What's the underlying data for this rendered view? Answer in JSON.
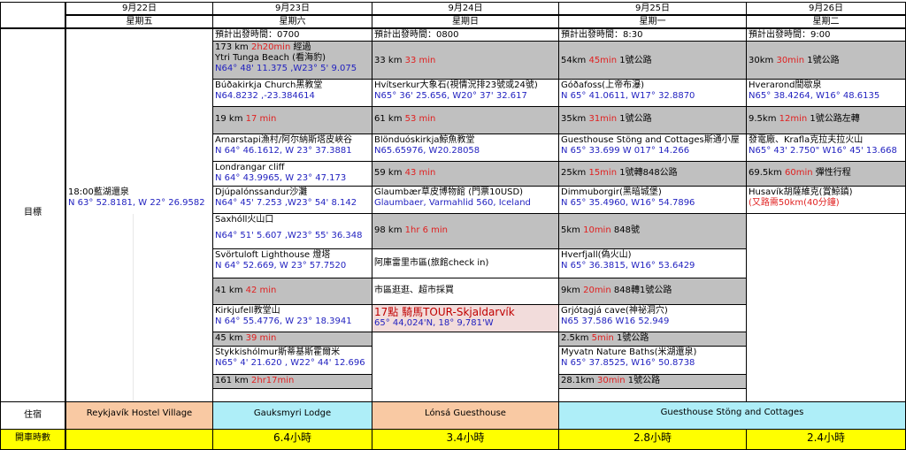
{
  "days": [
    {
      "date": "9月22日",
      "weekday": "星期五"
    },
    {
      "date": "9月23日",
      "weekday": "星期六"
    },
    {
      "date": "9月24日",
      "weekday": "星期日"
    },
    {
      "date": "9月25日",
      "weekday": "星期一"
    },
    {
      "date": "9月26日",
      "weekday": "星期二"
    }
  ],
  "row_labels": {
    "goal": "目標",
    "lodging": "住宿",
    "drive": "開車時數"
  },
  "d22": {
    "a": "18:00藍湖還泉",
    "b": "N 63° 52.8181, W 22° 26.9582"
  },
  "d23": {
    "depart": "預計出發時間：0700",
    "r1_dist": "173 km",
    "r1_time": "2h20min",
    "r1_note": "經過",
    "r2": "Ytri Tunga Beach (看海豹)",
    "r3": "N64° 48' 11.375 ,W23° 5' 9.075",
    "r4": "Búðakirkja Church黑教堂",
    "r5": "N64.8232 ,-23.384614",
    "r6_dist": "19 km",
    "r6_time": "17 min",
    "r7": "Arnarstapi漁村/阿尔納斯塔皮峽谷",
    "r8": "N 64° 46.1612, W 23° 37.3881",
    "r9": "Londrangar  cliff",
    "r10": "N 64° 43.9965, W 23° 47.173",
    "r11": "Djúpalónssandur沙灘",
    "r12": "N64° 45' 7.253 ,W23° 54' 8.142",
    "r13": "Saxhóll火山口",
    "r14": "N64° 51' 5.607 ,W23° 55' 36.348",
    "r15": "Svörtuloft Lighthouse 燈塔",
    "r16": "N 64° 52.669, W 23° 57.7520",
    "r17_dist": "41 km",
    "r17_time": "42 min",
    "r18": "Kirkjufell教堂山",
    "r19": "N 64° 55.4776, W 23° 18.3941",
    "r20_dist": "45 km",
    "r20_time": "39 min",
    "r21": "Stykkishólmur斯蒂基斯霍爾米",
    "r22": "N65° 4' 21.620 , W22° 44' 12.696",
    "r23_dist": "161 km",
    "r23_time": "2hr17min"
  },
  "d24": {
    "depart": "預計出發時間：0800",
    "r1_dist": "33 km",
    "r1_time": "33 min",
    "r2": "Hvítserkur大象石(視情況排23號或24號)",
    "r3": "N65° 36' 25.656, W20° 37' 32.617",
    "r4_dist": "61 km",
    "r4_time": "53 min",
    "r5": "Blönduóskirkja鯨魚教堂",
    "r6": "N65.65976, W20.28058",
    "r7_dist": "59 km",
    "r7_time": "43 min",
    "r8": "Glaumbær草皮博物館 (門票10USD)",
    "r9": "Glaumbaer, Varmahlid 560, Iceland",
    "r10_dist": "98 km",
    "r10_time": "1hr 6 min",
    "r11": "阿庫雷里市區(旅館check in)",
    "r12": "市區逛逛、超市採買",
    "r13": "17點 騎馬TOUR-Skjaldarvík",
    "r14": "65° 44,024'N, 18° 9,781'W"
  },
  "d25": {
    "depart": "預計出發時間：8:30",
    "r1_dist": "54km",
    "r1_time": "45min",
    "r1_note": "1號公路",
    "r2": "Góðafoss(上帝布瀑)",
    "r3": "N 65° 41.0611, W17° 32.8870",
    "r4_dist": "35km",
    "r4_time": "31min",
    "r4_note": "1號公路",
    "r5": " Guesthouse Stöng and Cottages斯通小屋",
    "r6": "N 65° 33.699 W 017° 14.266",
    "r7_dist": "25km",
    "r7_time": "15min",
    "r7_note": "1號轉848公路",
    "r8": "Dimmuborgir(黑暗城堡)",
    "r9": "N 65° 35.4960, W16° 54.7896",
    "r10_dist": "5km",
    "r10_time": "10min",
    "r10_note": "848號",
    "r11": "Hverfjall(偽火山)",
    "r12": "N 65° 36.3815, W16° 53.6429",
    "r13_dist": "9km",
    "r13_time": "20min",
    "r13_note": "848轉1號公路",
    "r14": "Grjótagjá cave(神祕洞穴)",
    "r15": "N65 37.586 W16 52.949",
    "r16_dist": "2.5km",
    "r16_time": "5min",
    "r16_note": "1號公路",
    "r17": "Myvatn Nature Baths(米湖還泉)",
    "r18": "N 65° 37.8525, W16° 50.8738",
    "r19_dist": "28.1km",
    "r19_time": "30min",
    "r19_note": "1號公路"
  },
  "d26": {
    "depart": "預計出發時間：9:00",
    "r1_dist": "30km",
    "r1_time": "30min",
    "r1_note": "1號公路",
    "r2": "Hverarond間歇泉",
    "r3": "N65° 38.4264, W16° 48.6135",
    "r4_dist": "9.5km",
    "r4_time": "12min",
    "r4_note": "1號公路左轉",
    "r5": "發電廠、Krafla克拉夫拉火山",
    "r6": "N65° 43' 2.750\" W16° 45' 13.668",
    "r7_dist": "69.5km",
    "r7_time": "60min",
    "r7_note": "彈性行程",
    "r8": "Husavík胡薩維克(賞鯨鎮)",
    "r9": "(又路需50km(40分鐘)"
  },
  "lodging": {
    "d22": "Reykjavík Hostel Village",
    "d23": "Gauksmyri Lodge",
    "d24": "Lónsá Guesthouse",
    "d25_26": "Guesthouse Stöng and Cottages"
  },
  "drive": {
    "d23": "6.4小時",
    "d24": "3.4小時",
    "d25": "2.8小時",
    "d26": "2.4小時"
  }
}
